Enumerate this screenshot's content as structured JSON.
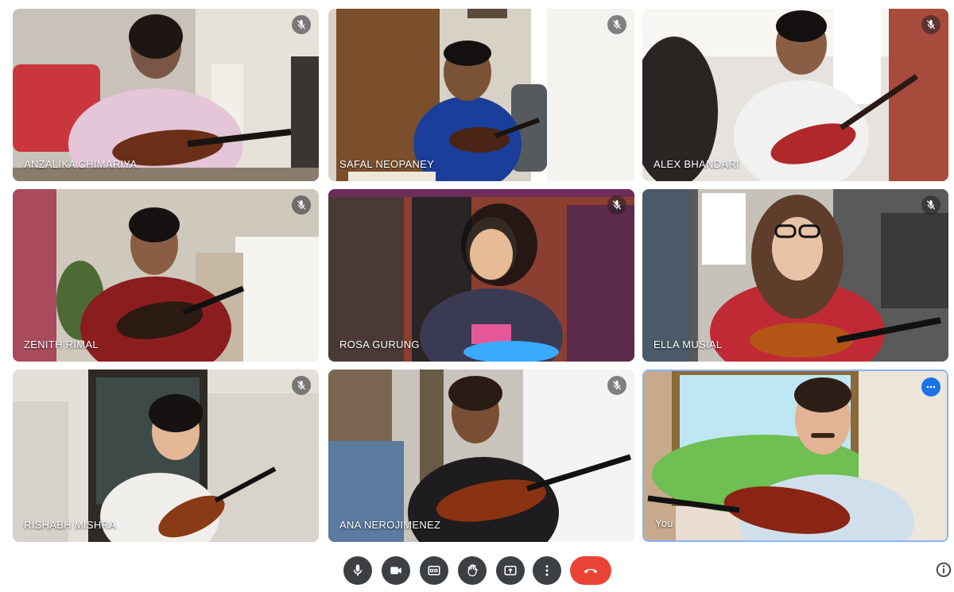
{
  "participants": [
    {
      "name": "ANZALIKA CHIMARIYA",
      "muted": true
    },
    {
      "name": "SAFAL NEOPANEY",
      "muted": true
    },
    {
      "name": "ALEX BHANDARI",
      "muted": true
    },
    {
      "name": "ZENITH RIMAL",
      "muted": true
    },
    {
      "name": "ROSA GURUNG",
      "muted": true
    },
    {
      "name": "ELLA MUSIAL",
      "muted": true
    },
    {
      "name": "RISHABH MISHRA",
      "muted": true
    },
    {
      "name": "ANA NEROJIMENEZ",
      "muted": true
    },
    {
      "name": "You",
      "muted": false,
      "is_self": true
    }
  ],
  "icons": {
    "mute": "mic-off-icon",
    "more": "more-options-icon",
    "toolbar": [
      "microphone-icon",
      "camera-icon",
      "captions-icon",
      "raise-hand-icon",
      "present-screen-icon",
      "more-vert-icon",
      "end-call-icon"
    ],
    "info": "info-icon"
  },
  "colors": {
    "control": "#3c4043",
    "end_call": "#ea4335",
    "self_border": "#8ab4f8",
    "more_button": "#1a73e8"
  }
}
